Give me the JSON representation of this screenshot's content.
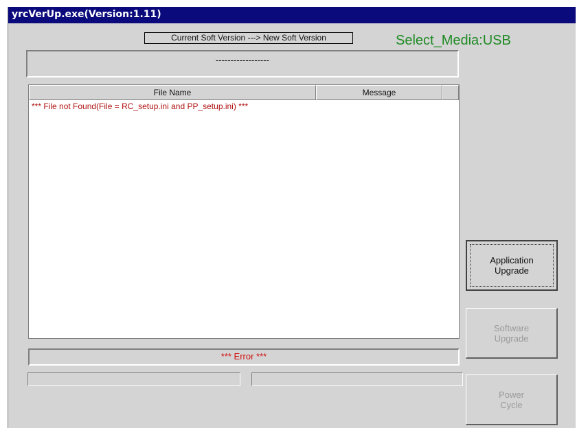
{
  "window": {
    "title": "yrcVerUp.exe(Version:1.11)"
  },
  "header": {
    "version_label": "Current Soft Version  ---> New Soft Version",
    "media_label": "Select_Media:USB",
    "version_value": "------------------"
  },
  "file_list": {
    "columns": [
      "File Name",
      "Message",
      ""
    ],
    "rows": [
      {
        "text": "*** File not Found(File = RC_setup.ini and PP_setup.ini) ***"
      }
    ]
  },
  "buttons": {
    "application_upgrade": "Application\nUpgrade",
    "software_upgrade": "Software\nUpgrade",
    "power_cycle": "Power\nCycle"
  },
  "status": {
    "error_text": "*** Error ***",
    "left_text": "",
    "right_text": ""
  },
  "colors": {
    "title_bar": "#0a0a7c",
    "media_label": "#1d8a22",
    "error_text": "#d21010",
    "row_text": "#b01010",
    "window_bg": "#d4d4d4"
  }
}
